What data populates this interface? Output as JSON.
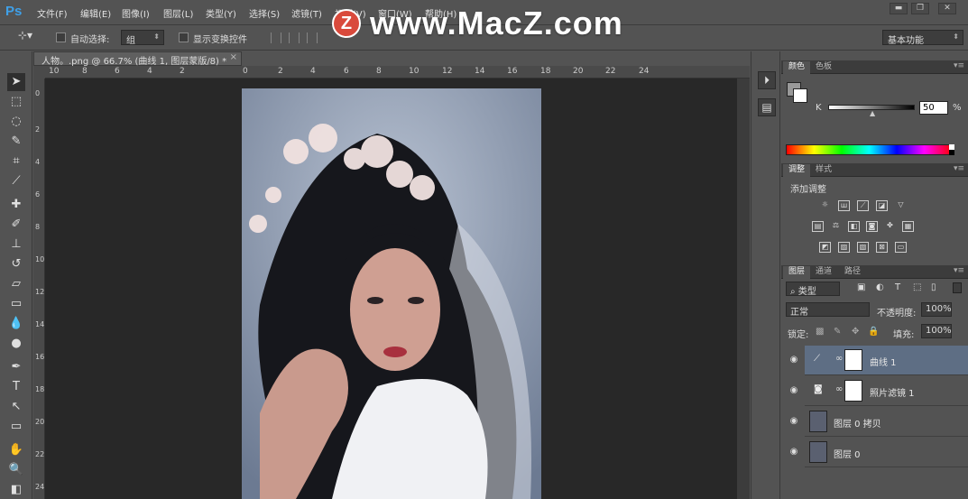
{
  "app": {
    "logo": "Ps"
  },
  "menu": [
    "文件(F)",
    "编辑(E)",
    "图像(I)",
    "图层(L)",
    "类型(Y)",
    "选择(S)",
    "滤镜(T)",
    "视图(V)",
    "窗口(W)",
    "帮助(H)"
  ],
  "watermark": {
    "badge": "Z",
    "text": "www.MacZ.com"
  },
  "window_controls": {
    "minimize": "▬",
    "restore": "❐",
    "close": "✕"
  },
  "options": {
    "auto_select_label": "自动选择:",
    "auto_select_value": "组",
    "show_transform_label": "显示变换控件",
    "workspace": "基本功能"
  },
  "document": {
    "tab_title": "人物。.png @ 66.7% (曲线 1, 图层蒙版/8) *",
    "close": "×"
  },
  "ruler": {
    "top": [
      "10",
      "8",
      "6",
      "4",
      "2",
      "0",
      "2",
      "4",
      "6",
      "8",
      "10",
      "12",
      "14",
      "16",
      "18",
      "20",
      "22",
      "24"
    ],
    "left": [
      "0",
      "2",
      "4",
      "6",
      "8",
      "10",
      "12",
      "14",
      "16",
      "18",
      "20",
      "22",
      "24"
    ]
  },
  "panels": {
    "color": {
      "tabs": [
        "颜色",
        "色板"
      ],
      "channel": "K",
      "value": "50",
      "unit": "%"
    },
    "adjustments": {
      "tabs": [
        "调整",
        "样式"
      ],
      "title": "添加调整"
    },
    "layers": {
      "tabs": [
        "图层",
        "通道",
        "路径"
      ],
      "filter_type": "类型",
      "blend_mode": "正常",
      "opacity_label": "不透明度:",
      "opacity": "100%",
      "lock_label": "锁定:",
      "fill_label": "填充:",
      "fill": "100%",
      "rows": [
        {
          "name": "曲线 1",
          "selected": true
        },
        {
          "name": "照片滤镜 1",
          "selected": false
        },
        {
          "name": "图层 0 拷贝",
          "selected": false
        },
        {
          "name": "图层 0",
          "selected": false
        }
      ]
    }
  }
}
